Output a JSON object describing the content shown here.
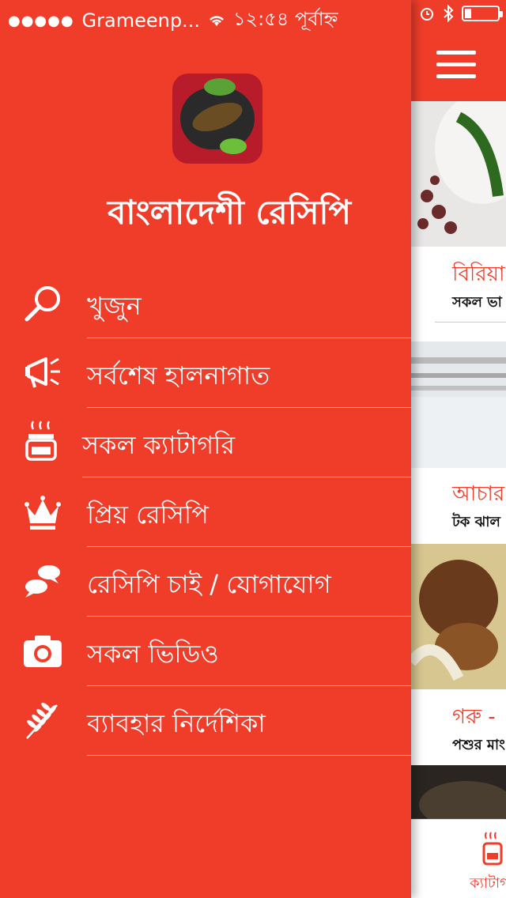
{
  "status_bar": {
    "carrier": "Grameenp...",
    "time": "১২:৫৪ পূর্বাহ্ন",
    "signal_icon": "signal-dots-icon",
    "wifi_icon": "wifi-icon",
    "alarm_icon": "alarm-icon",
    "bluetooth_icon": "bluetooth-icon",
    "battery_level": 0.2
  },
  "drawer": {
    "app_title": "বাংলাদেশী রেসিপি",
    "background_color": "#f03d2a",
    "items": [
      {
        "label": "খুজুন",
        "icon": "search-icon"
      },
      {
        "label": "সর্বশেষ হালনাগাত",
        "icon": "megaphone-icon"
      },
      {
        "label": "সকল ক্যাটাগরি",
        "icon": "cooking-pot-icon"
      },
      {
        "label": "প্রিয় রেসিপি",
        "icon": "crown-icon"
      },
      {
        "label": "রেসিপি চাই / যোগাযোগ",
        "icon": "chat-bubbles-icon"
      },
      {
        "label": "সকল ভিডিও",
        "icon": "camera-icon"
      },
      {
        "label": "ব্যাবহার নির্দেশিকা",
        "icon": "wheat-icon"
      }
    ]
  },
  "main": {
    "menu_icon": "hamburger-menu-icon",
    "cards": [
      {
        "title": "বিরিয়া",
        "subtitle": "সকল ভা"
      },
      {
        "title": "আচার",
        "subtitle": "টক ঝাল"
      },
      {
        "title": "গরু -",
        "subtitle": "পশুর মাং"
      }
    ],
    "bottom_tab_label": "ক্যাটাগ",
    "accent_color": "#f03d2a"
  }
}
